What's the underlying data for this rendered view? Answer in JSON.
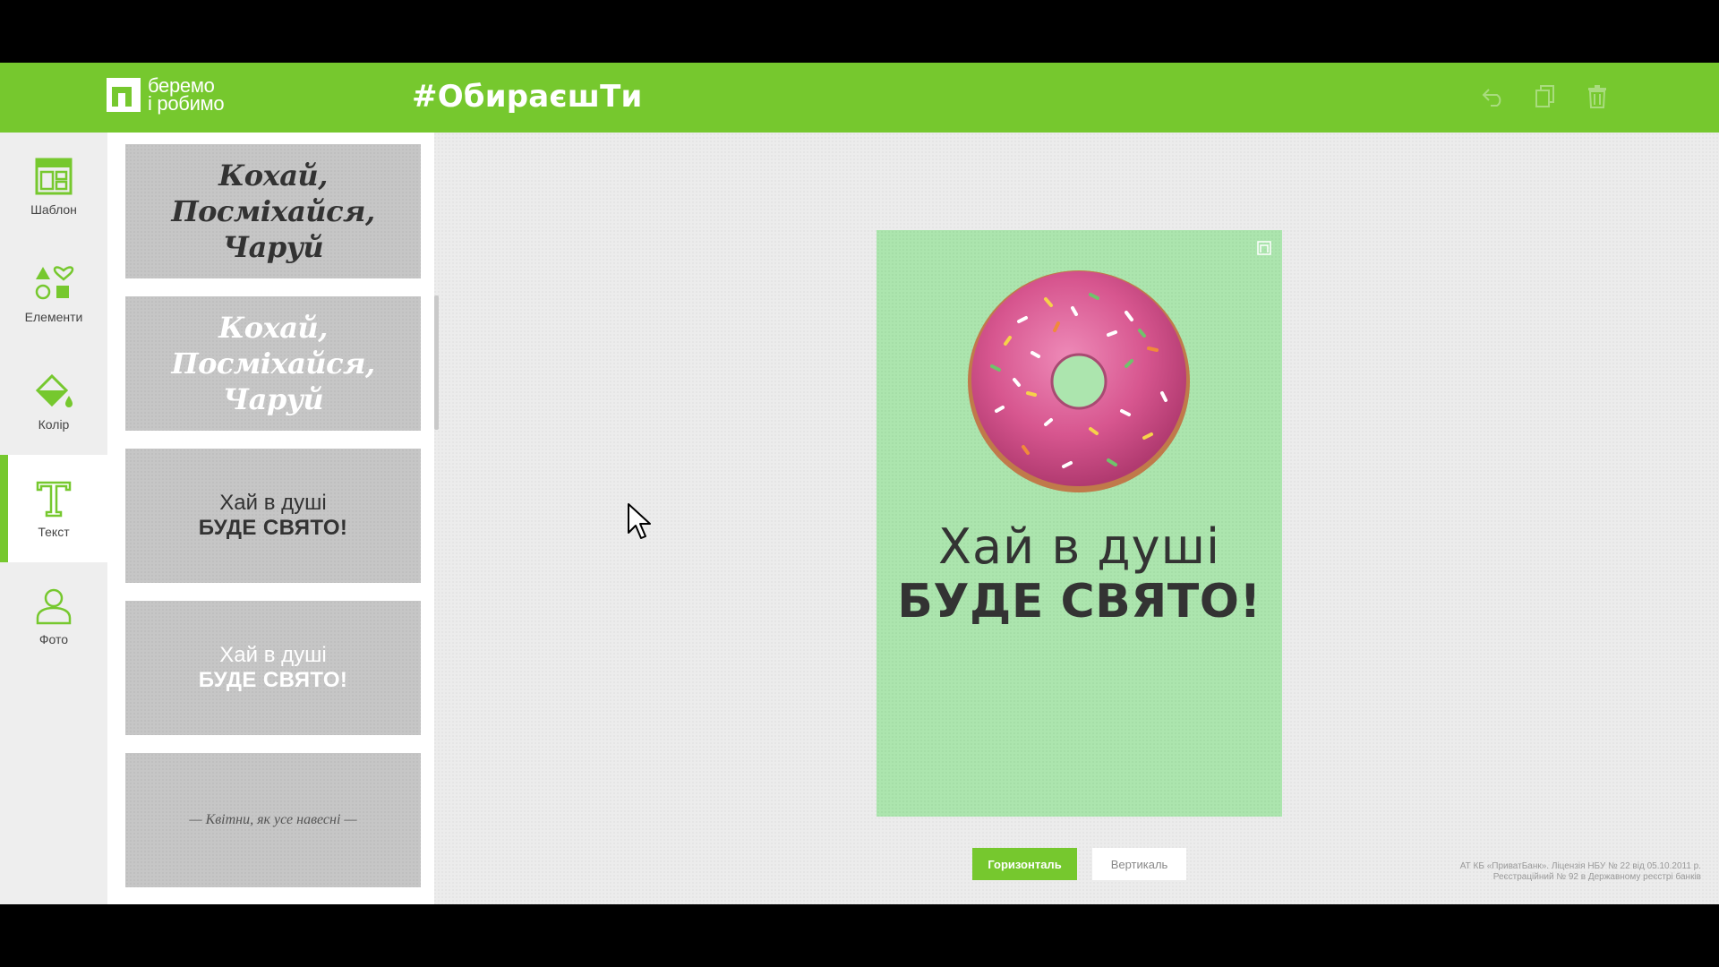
{
  "header": {
    "logo_line1": "беремо",
    "logo_line2": "і робимо",
    "hashtag": "#ОбираєшТи",
    "brand_color": "#76c82e",
    "actions": [
      "undo-icon",
      "copy-icon",
      "trash-icon"
    ]
  },
  "sidebar": {
    "items": [
      {
        "label": "Шаблон",
        "icon": "template-icon"
      },
      {
        "label": "Елементи",
        "icon": "shapes-icon"
      },
      {
        "label": "Колір",
        "icon": "paint-bucket-icon"
      },
      {
        "label": "Текст",
        "icon": "text-icon",
        "active": true
      },
      {
        "label": "Фото",
        "icon": "person-icon"
      }
    ]
  },
  "templates": [
    {
      "line1": "Кохай,",
      "line2": "Посміхайся,",
      "line3": "Чаруй"
    },
    {
      "line1": "Кохай,",
      "line2": "Посміхайся,",
      "line3": "Чаруй"
    },
    {
      "line1": "Хай в душі",
      "line2": "БУДЕ СВЯТО!"
    },
    {
      "line1": "Хай в душі",
      "line2": "БУДЕ СВЯТО!"
    },
    {
      "line1": "— Квітни, як усе навесні —"
    }
  ],
  "poster": {
    "line1": "Хай в душі",
    "line2": "БУДЕ СВЯТО!",
    "background": "#ace5ae"
  },
  "orientation": {
    "horizontal": "Горизонталь",
    "vertical": "Вертикаль"
  },
  "legal": {
    "line1": "АТ КБ «ПриватБанк». Ліцензія НБУ № 22 від 05.10.2011 р.",
    "line2": "Реєстраційний № 92 в Державному реєстрі банків"
  }
}
